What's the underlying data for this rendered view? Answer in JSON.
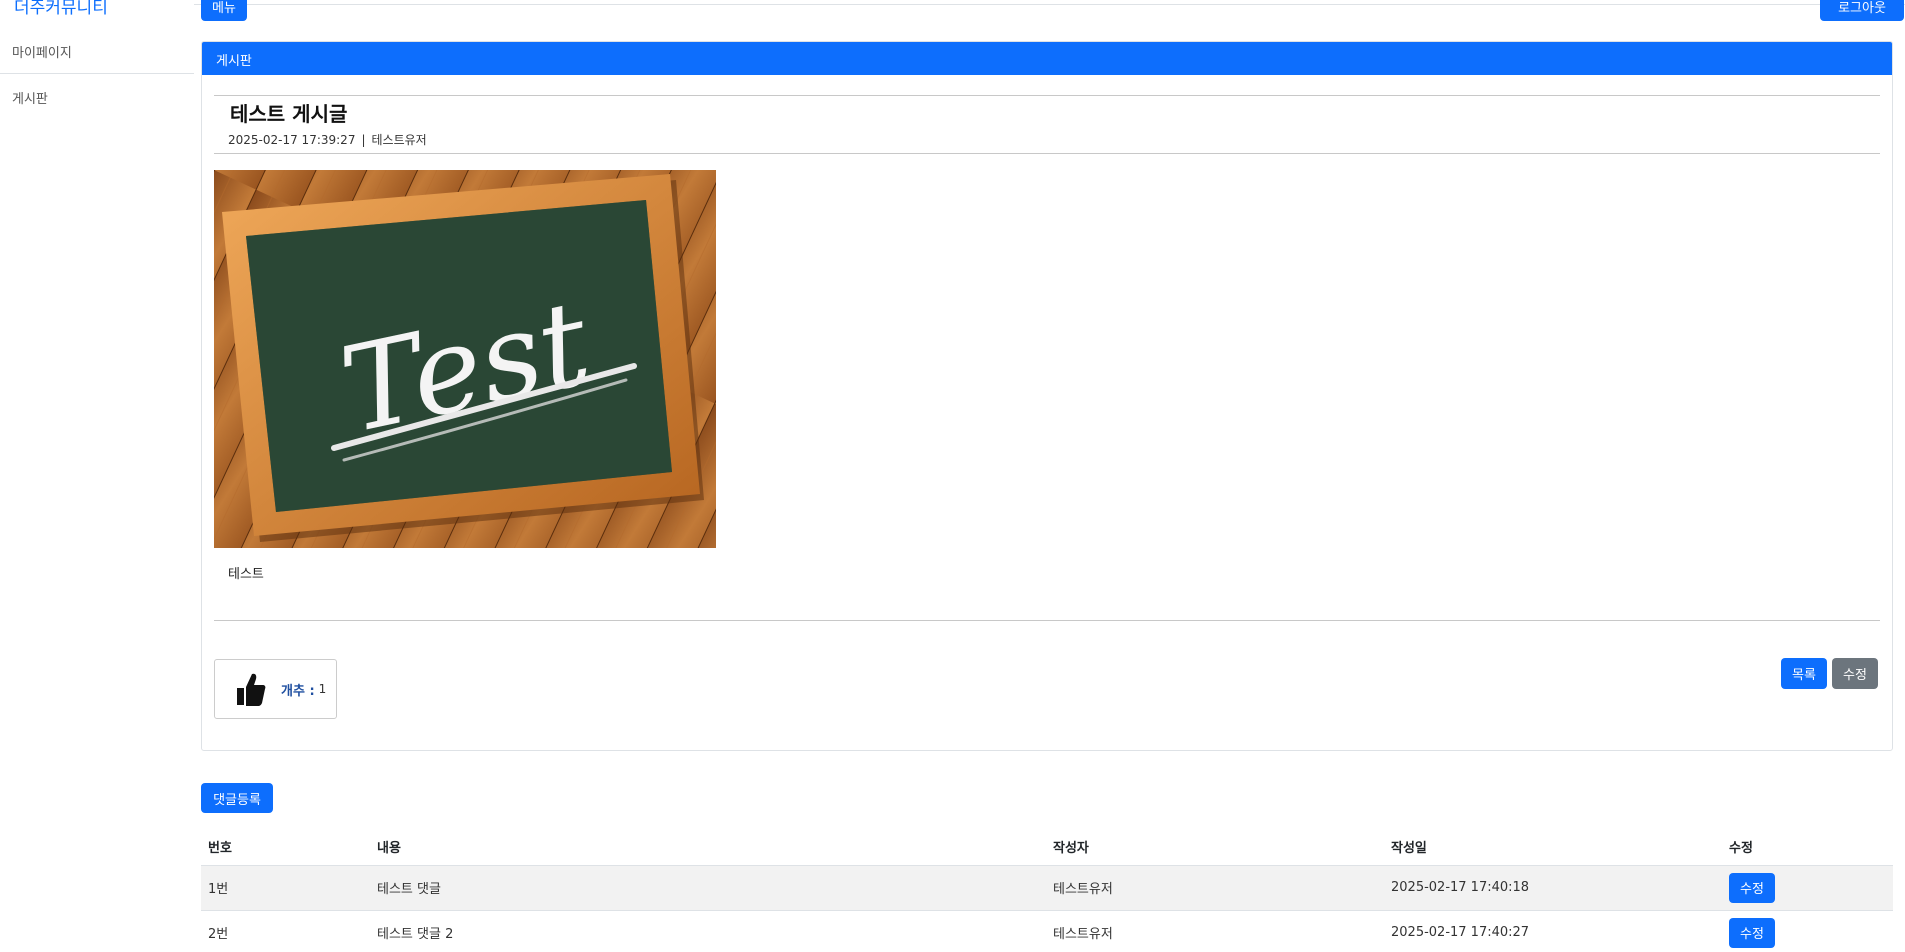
{
  "sidebar": {
    "brand": "더주커뮤니티",
    "items": [
      {
        "label": "마이페이지"
      },
      {
        "label": "게시판"
      }
    ]
  },
  "topbar": {
    "menu_label": "메뉴",
    "logout_label": "로그아웃"
  },
  "card": {
    "header": "게시판",
    "post": {
      "title": "테스트 게시글",
      "date": "2025-02-17 17:39:27",
      "separator": "|",
      "author": "테스트유저",
      "image_text": "Test",
      "body": "테스트"
    },
    "like": {
      "label": "개추 :",
      "count": "1"
    },
    "buttons": {
      "list": "목록",
      "edit": "수정"
    }
  },
  "comments": {
    "add_button": "댓글등록",
    "headers": [
      "번호",
      "내용",
      "작성자",
      "작성일",
      "수정"
    ],
    "rows": [
      {
        "no": "1번",
        "content": "테스트 댓글",
        "author": "테스트유저",
        "date": "2025-02-17 17:40:18",
        "edit": "수정"
      },
      {
        "no": "2번",
        "content": "테스트 댓글 2",
        "author": "테스트유저",
        "date": "2025-02-17 17:40:27",
        "edit": "수정"
      }
    ]
  },
  "colors": {
    "primary": "#0d6efd",
    "secondary": "#6c757d",
    "like_label": "#1f4fa0"
  }
}
